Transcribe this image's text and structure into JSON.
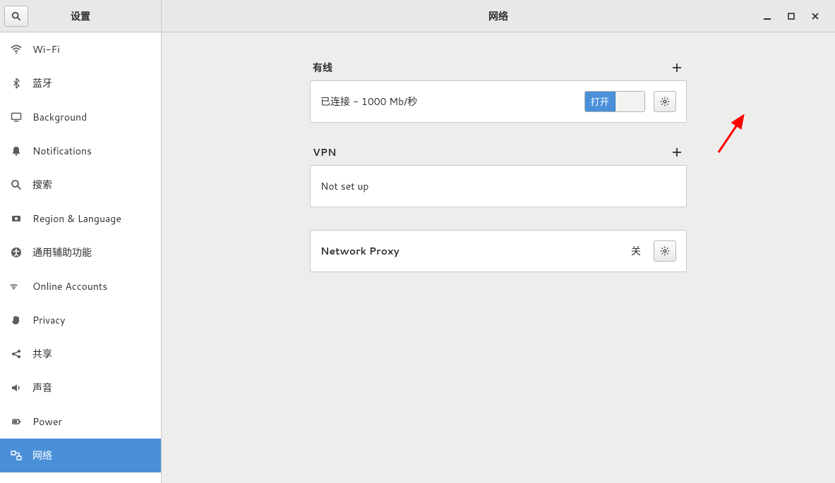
{
  "sidebar": {
    "title": "设置",
    "items": [
      {
        "label": "Wi-Fi",
        "icon": "wifi",
        "selected": false
      },
      {
        "label": "蓝牙",
        "icon": "bluetooth",
        "selected": false
      },
      {
        "label": "Background",
        "icon": "monitor",
        "selected": false
      },
      {
        "label": "Notifications",
        "icon": "bell",
        "selected": false
      },
      {
        "label": "搜索",
        "icon": "search",
        "selected": false
      },
      {
        "label": "Region & Language",
        "icon": "flag",
        "selected": false
      },
      {
        "label": "通用辅助功能",
        "icon": "accessibility",
        "selected": false
      },
      {
        "label": "Online Accounts",
        "icon": "cloud",
        "selected": false
      },
      {
        "label": "Privacy",
        "icon": "hand",
        "selected": false
      },
      {
        "label": "共享",
        "icon": "share",
        "selected": false
      },
      {
        "label": "声音",
        "icon": "sound",
        "selected": false
      },
      {
        "label": "Power",
        "icon": "power",
        "selected": false
      },
      {
        "label": "网络",
        "icon": "network",
        "selected": true
      }
    ]
  },
  "header": {
    "title": "网络"
  },
  "wired": {
    "title": "有线",
    "connection_status": "已连接 - 1000 Mb/秒",
    "switch_on_label": "打开"
  },
  "vpn": {
    "title": "VPN",
    "empty_text": "Not set up"
  },
  "proxy": {
    "title": "Network Proxy",
    "status": "关"
  }
}
